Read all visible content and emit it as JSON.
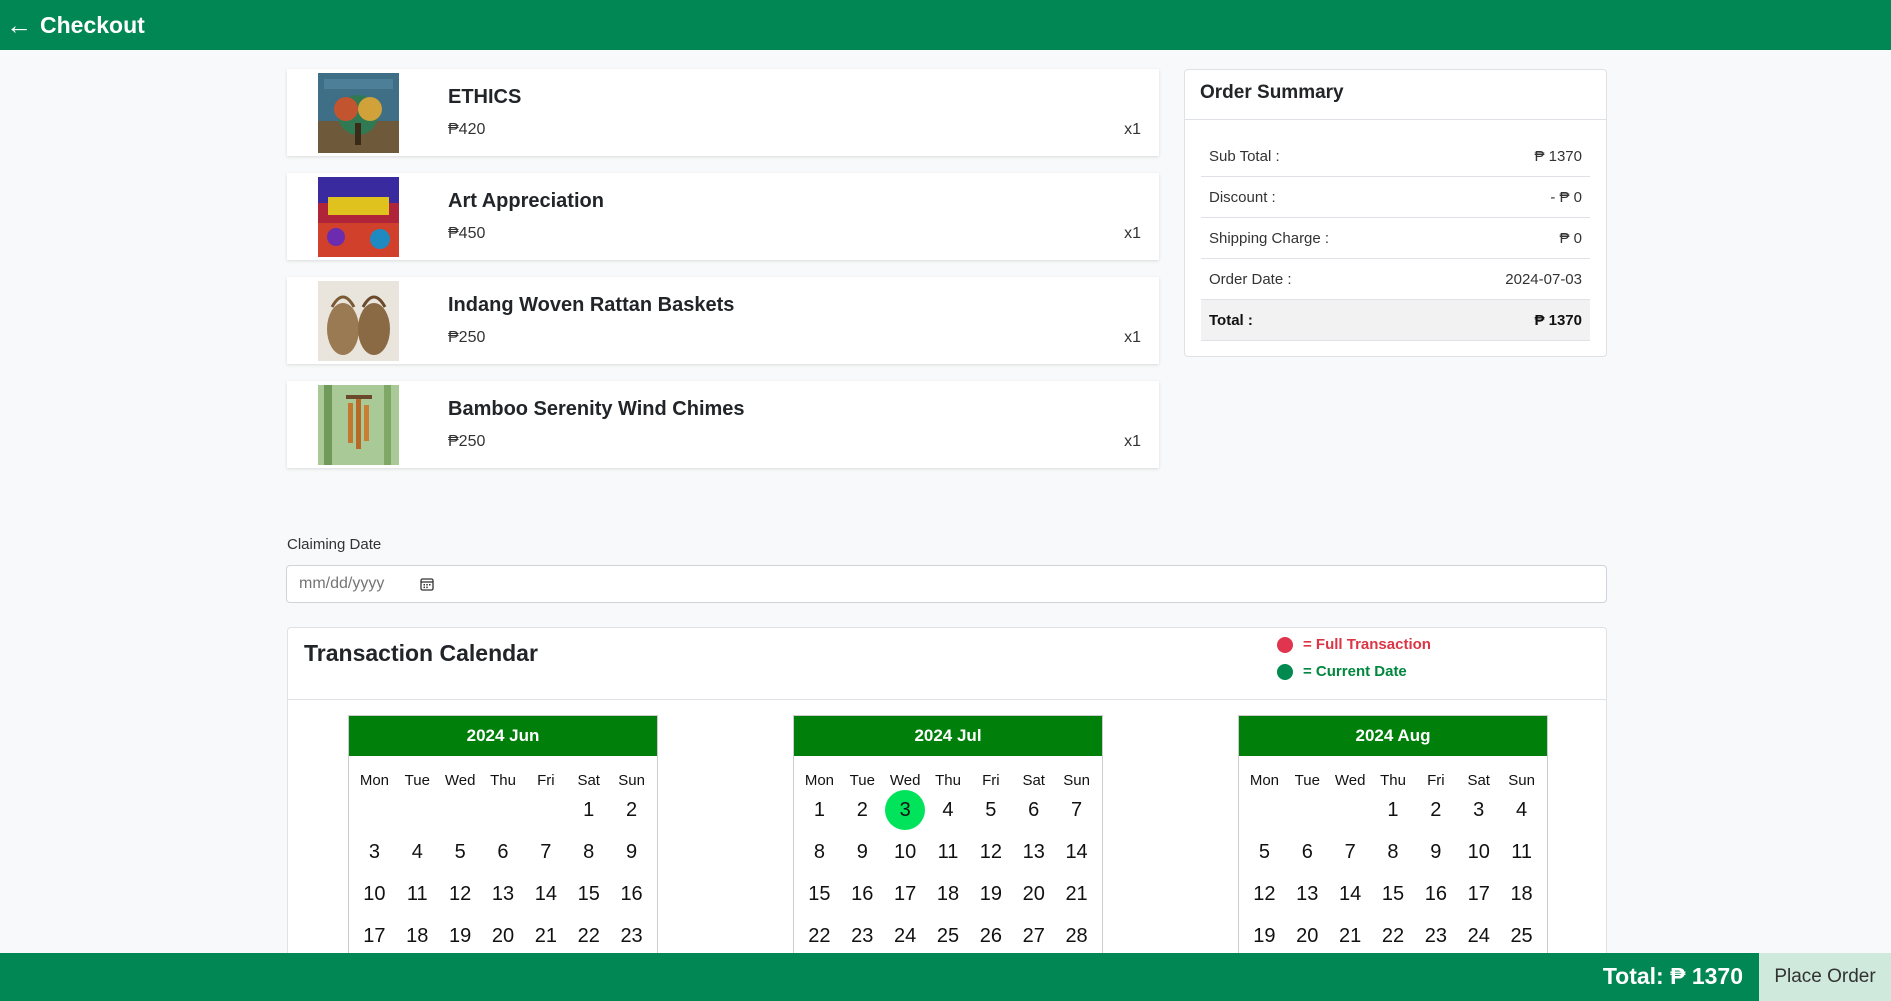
{
  "header": {
    "back_icon": "arrow-left-icon",
    "title": "Checkout"
  },
  "items": [
    {
      "name": "ETHICS",
      "price": "₱420",
      "qty": "x1"
    },
    {
      "name": "Art Appreciation",
      "price": "₱450",
      "qty": "x1"
    },
    {
      "name": "Indang Woven Rattan Baskets",
      "price": "₱250",
      "qty": "x1"
    },
    {
      "name": "Bamboo Serenity Wind Chimes",
      "price": "₱250",
      "qty": "x1"
    }
  ],
  "summary": {
    "title": "Order Summary",
    "rows": [
      {
        "label": "Sub Total :",
        "value": "₱ 1370"
      },
      {
        "label": "Discount :",
        "value": "- ₱ 0"
      },
      {
        "label": "Shipping Charge :",
        "value": "₱ 0"
      },
      {
        "label": "Order Date :",
        "value": "2024-07-03"
      },
      {
        "label": "Total :",
        "value": "₱ 1370"
      }
    ]
  },
  "claiming": {
    "label": "Claiming Date",
    "placeholder": "mm/dd/yyyy"
  },
  "calendar": {
    "title": "Transaction Calendar",
    "legend_full": "= Full Transaction",
    "legend_current": "= Current Date",
    "weekdays": [
      "Mon",
      "Tue",
      "Wed",
      "Thu",
      "Fri",
      "Sat",
      "Sun"
    ],
    "months": [
      {
        "label": "2024 Jun",
        "offset": 5,
        "days": 23
      },
      {
        "label": "2024 Jul",
        "offset": 0,
        "days": 28,
        "today": 3
      },
      {
        "label": "2024 Aug",
        "offset": 3,
        "days": 25
      }
    ]
  },
  "colors": {
    "brand": "#008753",
    "calendar_header": "#00800a",
    "full_transaction": "#e0344f",
    "current_date": "#008a4f",
    "today_highlight": "#00e35a"
  },
  "footer": {
    "total": "Total: ₱ 1370",
    "place_order": "Place Order"
  }
}
